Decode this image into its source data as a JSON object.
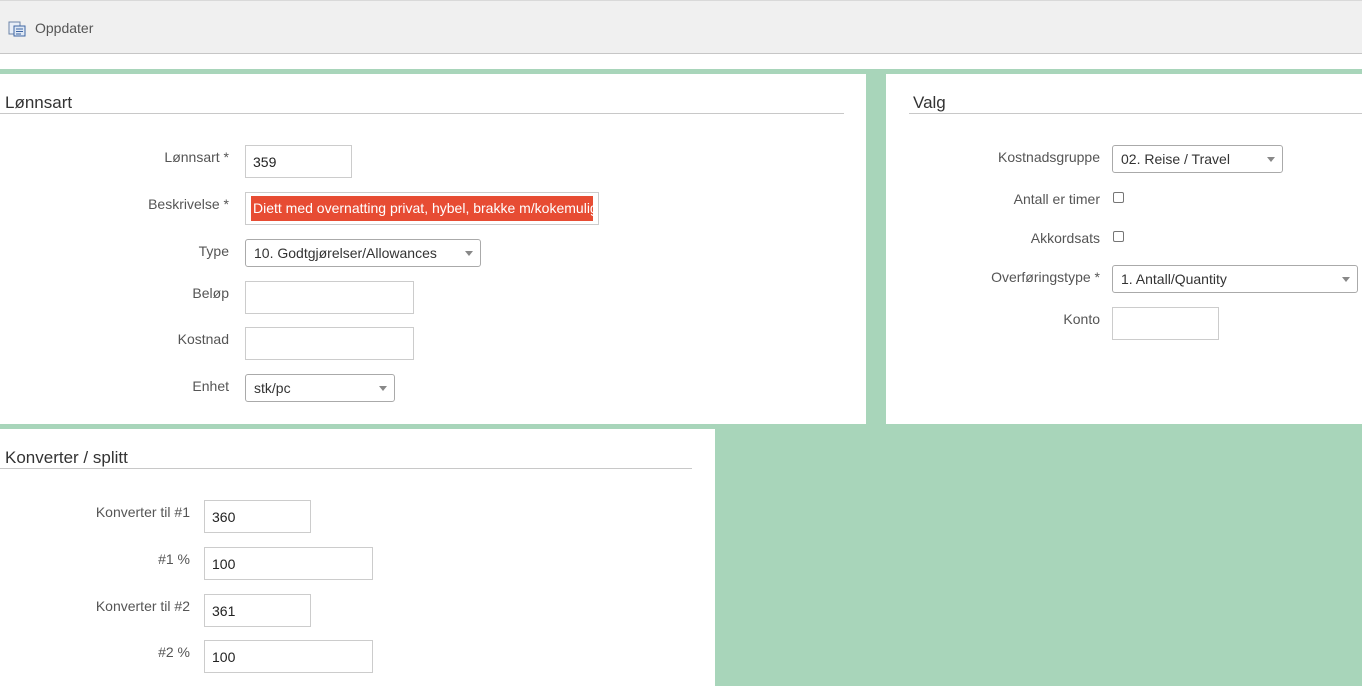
{
  "toolbar": {
    "refresh_label": "Oppdater"
  },
  "lonnsart_panel": {
    "title": "Lønnsart",
    "fields": {
      "lonnsart": {
        "label": "Lønnsart *",
        "value": "359"
      },
      "beskrivelse": {
        "label": "Beskrivelse *",
        "value": "Diett med overnatting privat, hybel, brakke m/kokemulighet"
      },
      "type": {
        "label": "Type",
        "value": "10. Godtgjørelser/Allowances"
      },
      "belop": {
        "label": "Beløp",
        "value": ""
      },
      "kostnad": {
        "label": "Kostnad",
        "value": ""
      },
      "enhet": {
        "label": "Enhet",
        "value": "stk/pc"
      }
    }
  },
  "valg_panel": {
    "title": "Valg",
    "fields": {
      "kostnadsgruppe": {
        "label": "Kostnadsgruppe",
        "value": "02. Reise / Travel"
      },
      "antall_er_timer": {
        "label": "Antall er timer",
        "checked": false
      },
      "akkordsats": {
        "label": "Akkordsats",
        "checked": false
      },
      "overforingstype": {
        "label": "Overføringstype *",
        "value": "1. Antall/Quantity"
      },
      "konto": {
        "label": "Konto",
        "value": ""
      }
    }
  },
  "konverter_panel": {
    "title": "Konverter / splitt",
    "fields": {
      "konverter1": {
        "label": "Konverter til #1",
        "value": "360"
      },
      "pct1": {
        "label": "#1 %",
        "value": "100"
      },
      "konverter2": {
        "label": "Konverter til #2",
        "value": "361"
      },
      "pct2": {
        "label": "#2 %",
        "value": "100"
      }
    }
  },
  "colors": {
    "background": "#a8d5ba",
    "highlight": "#e74c33"
  }
}
